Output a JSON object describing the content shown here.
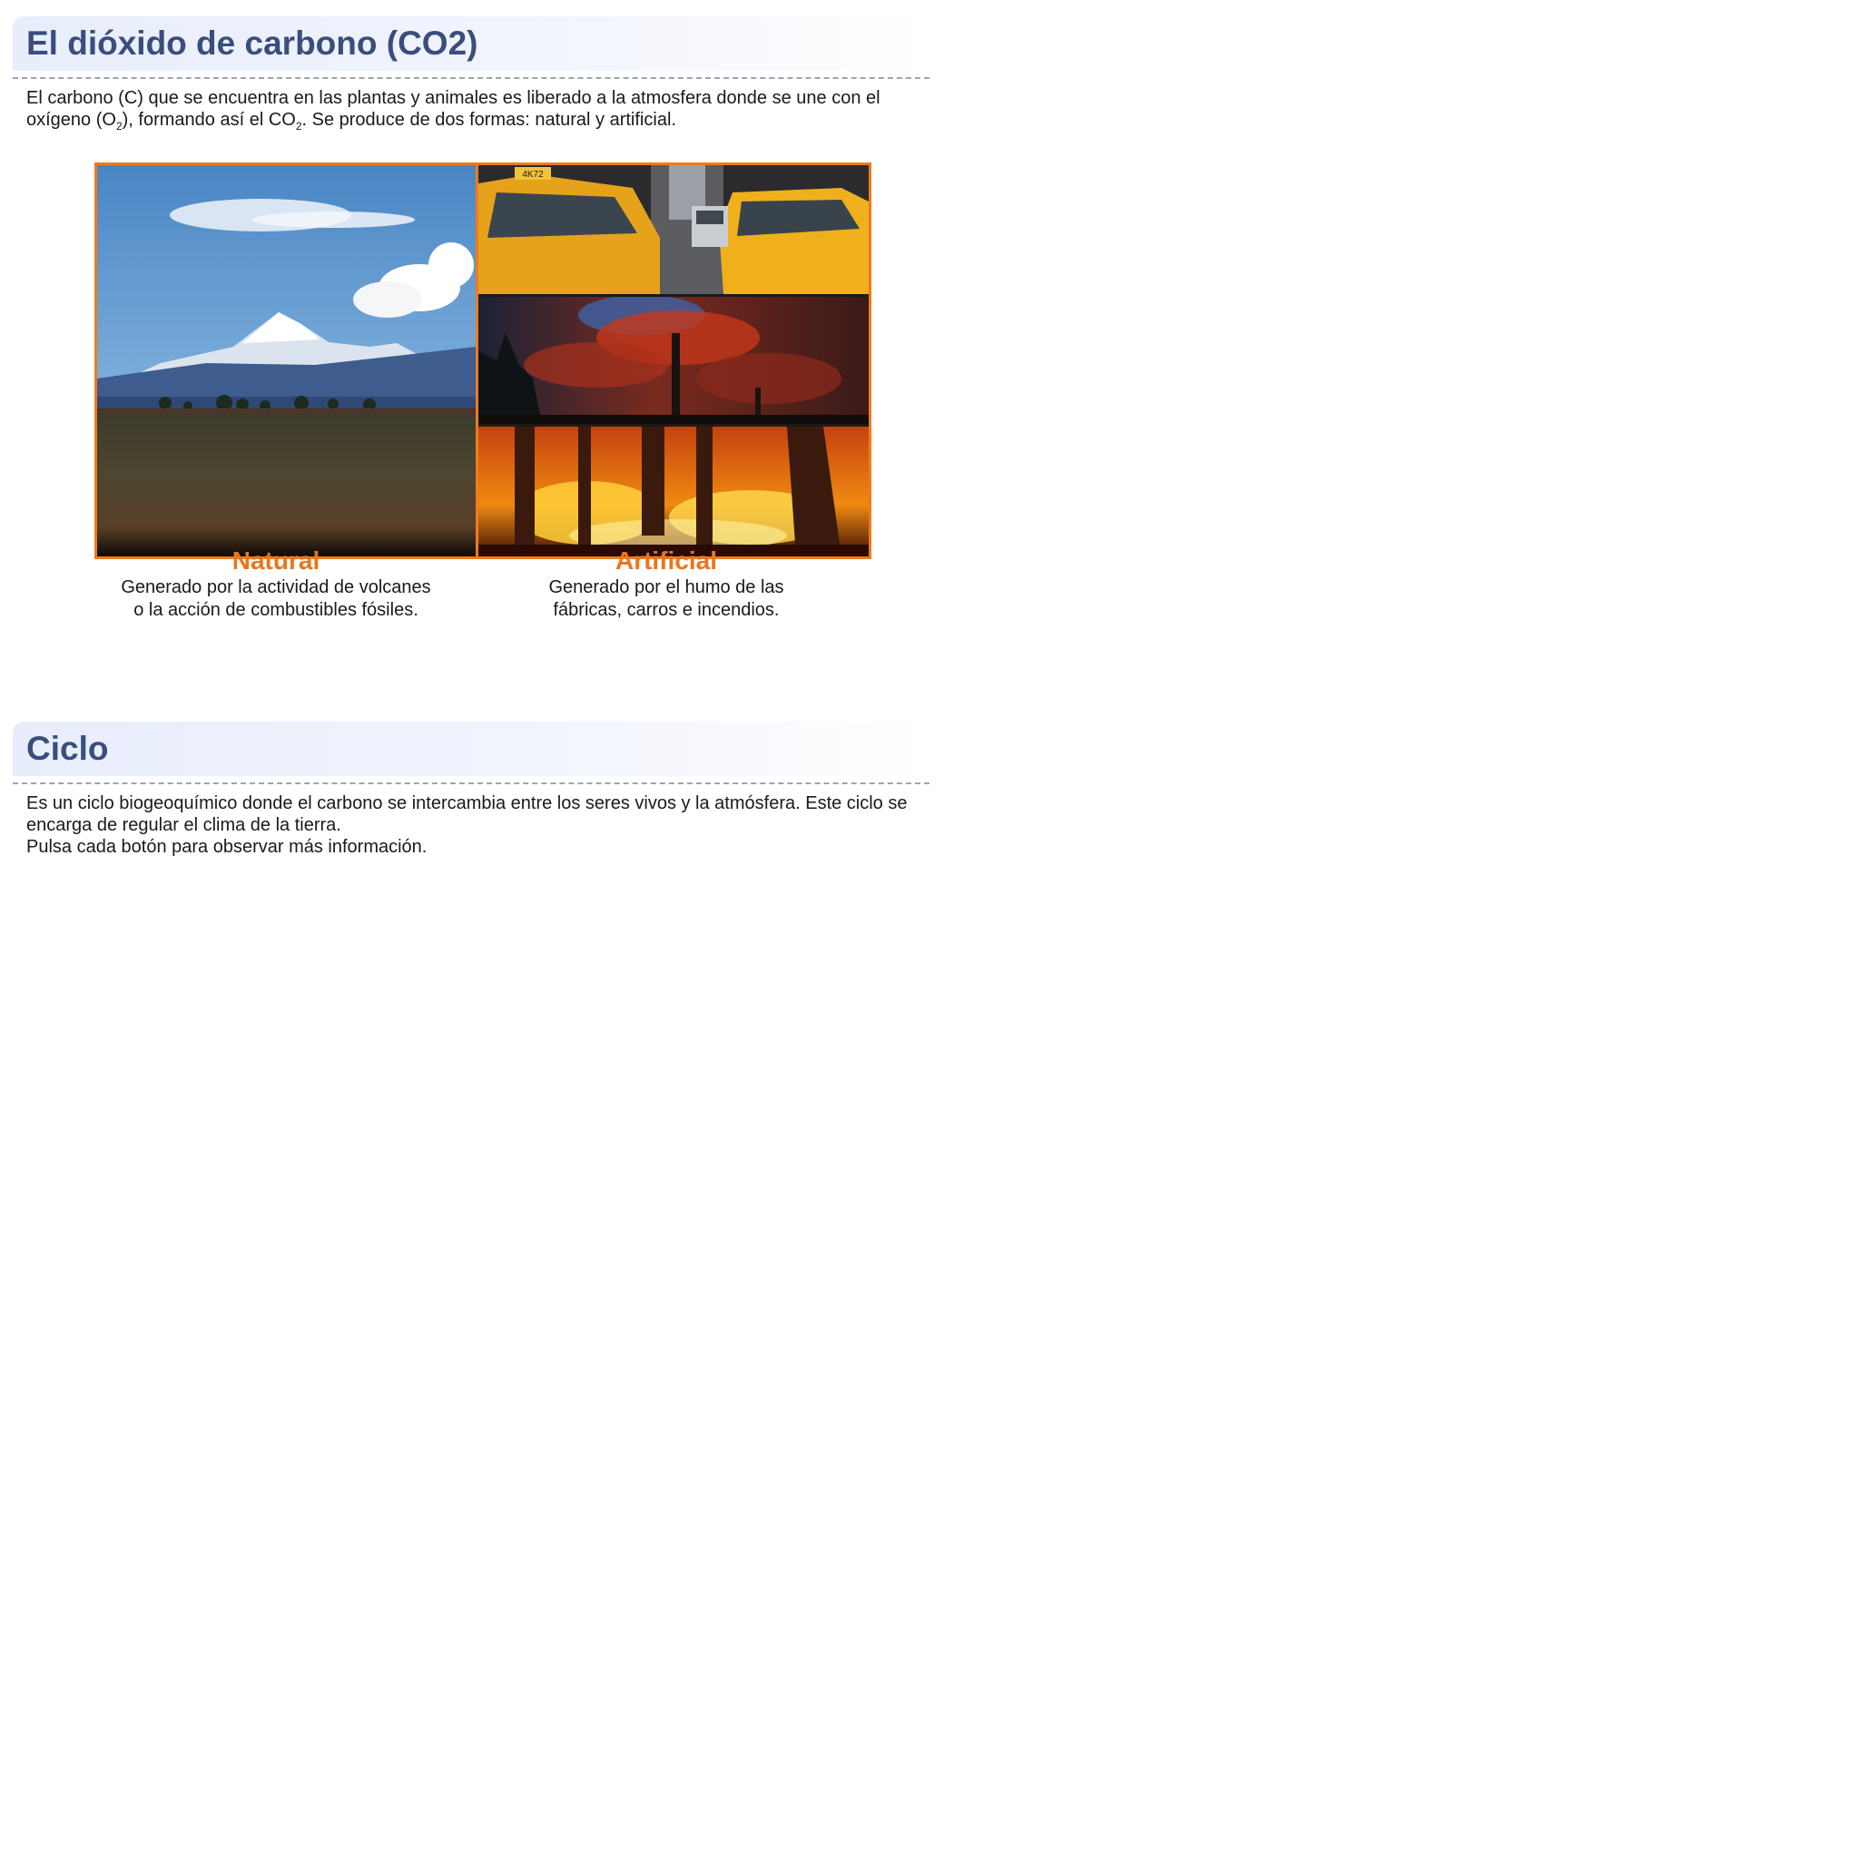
{
  "sections": {
    "co2": {
      "title": "El dióxido de carbono (CO2)",
      "intro_part1": "El carbono (C) que se encuentra en las plantas y animales es liberado a la atmosfera donde se une con el oxígeno (O",
      "sub_2_a": "2",
      "intro_part2": "), formando así el CO",
      "sub_2_b": "2",
      "intro_part3": ". Se produce de dos formas: natural y artificial.",
      "natural": {
        "title": "Natural",
        "line1": "Generado por la actividad de volcanes",
        "line2": "o la acción de combustibles fósiles."
      },
      "artificial": {
        "title": "Artificial",
        "line1": "Generado por el humo de las",
        "line2": "fábricas, carros e incendios."
      },
      "taxi_sign": "4K72"
    },
    "ciclo": {
      "title": "Ciclo",
      "line1": "Es un ciclo biogeoquímico donde el carbono se intercambia entre los seres vivos y la atmósfera. Este ciclo se encarga de regular el clima de la tierra.",
      "line2": "Pulsa cada botón para observar más información."
    }
  },
  "colors": {
    "title": "#394e7d",
    "accent": "#e8761e",
    "frame": "#f07b1a"
  }
}
